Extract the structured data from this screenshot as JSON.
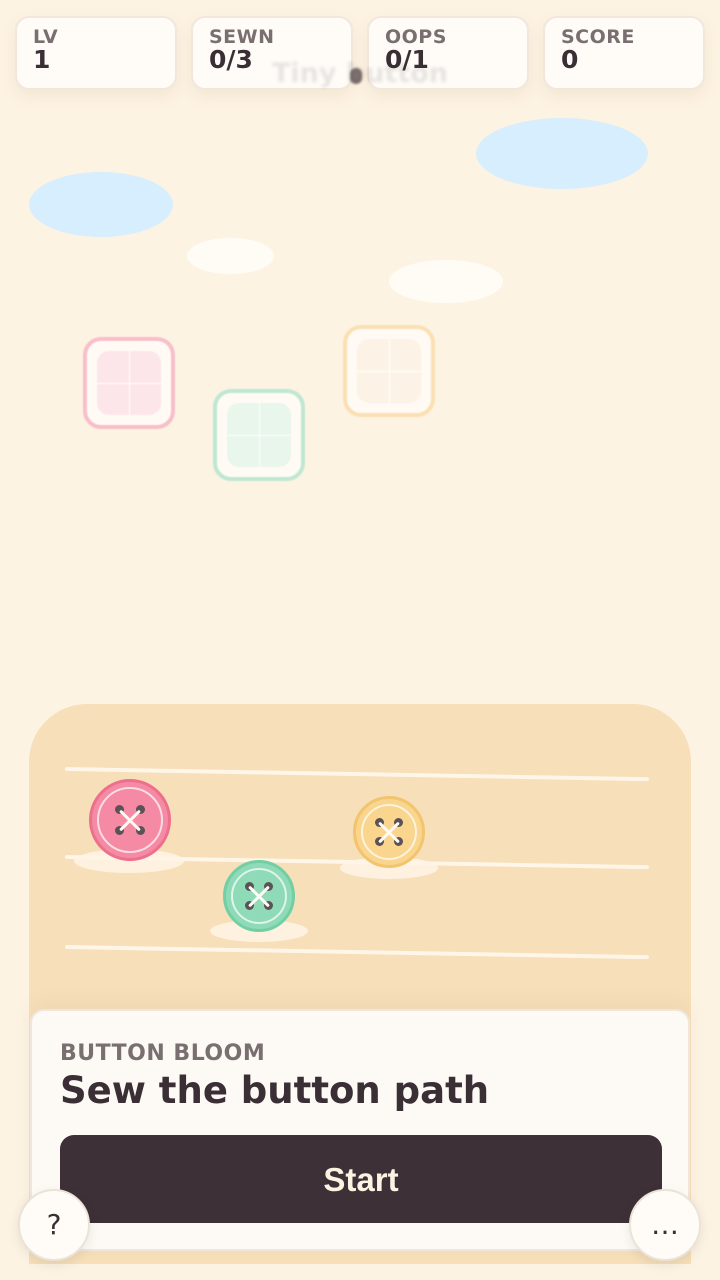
{
  "hud": {
    "level": {
      "label": "LV",
      "value": "1"
    },
    "sewn": {
      "label": "SEWN",
      "value": "0/3"
    },
    "oops": {
      "label": "OOPS",
      "value": "0/1"
    },
    "score": {
      "label": "SCORE",
      "value": "0"
    }
  },
  "ghost_title": "Tiny button",
  "colors": {
    "background": "#fdf3e3",
    "board": "#f6dfb9",
    "pink": "#f48aa3",
    "mint": "#8fdbb8",
    "yellow": "#f9d58e",
    "dark": "#3d3037",
    "cloud": "#d6eefd"
  },
  "tiles": [
    {
      "color": "pink",
      "icon": "square-pad-icon"
    },
    {
      "color": "mint",
      "icon": "square-pad-icon"
    },
    {
      "color": "yellow",
      "icon": "square-pad-icon"
    }
  ],
  "buttons": [
    {
      "color": "pink",
      "icon": "sewing-button-icon"
    },
    {
      "color": "mint",
      "icon": "sewing-button-icon"
    },
    {
      "color": "yellow",
      "icon": "sewing-button-icon"
    }
  ],
  "panel": {
    "subtitle": "BUTTON BLOOM",
    "title": "Sew the button path",
    "start_label": "Start"
  },
  "help_label": "?",
  "more_label": "…"
}
